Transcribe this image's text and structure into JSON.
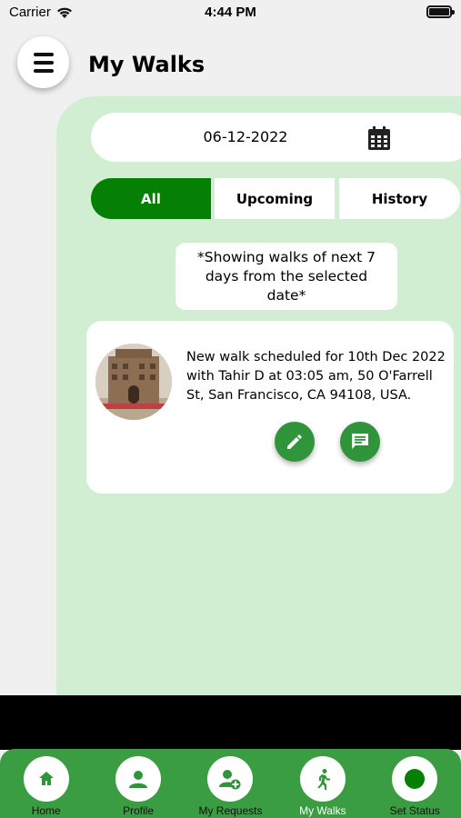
{
  "status_bar": {
    "carrier": "Carrier",
    "time": "4:44 PM"
  },
  "header": {
    "title": "My Walks"
  },
  "date_picker": {
    "value": "06-12-2022"
  },
  "tabs": [
    {
      "label": "All",
      "active": true
    },
    {
      "label": "Upcoming",
      "active": false
    },
    {
      "label": "History",
      "active": false
    }
  ],
  "notice": {
    "line1": "*Showing walks of next 7",
    "line2": "days from the selected",
    "line3": "date*"
  },
  "walks": [
    {
      "line1": "New walk scheduled for 10th Dec 2022",
      "line2": "with Tahir D at 03:05 am, 50 O'Farrell",
      "line3": "St, San Francisco, CA 94108, USA."
    }
  ],
  "bottom_nav": [
    {
      "label": "Home",
      "icon": "home-icon"
    },
    {
      "label": "Profile",
      "icon": "person-icon"
    },
    {
      "label": "My Requests",
      "icon": "person-add-icon"
    },
    {
      "label": "My Walks",
      "icon": "walk-icon",
      "active": true
    },
    {
      "label": "Set Status",
      "icon": "status-dot-icon"
    }
  ],
  "colors": {
    "primary": "#058005",
    "panel": "#d2eed2",
    "nav": "#3a9d42",
    "action": "#30953a"
  }
}
